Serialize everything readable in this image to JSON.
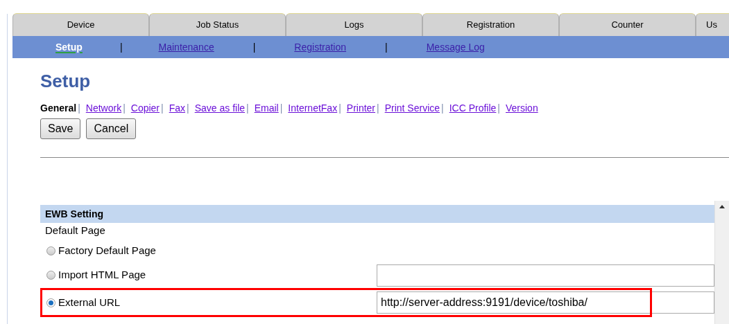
{
  "tabs": [
    {
      "label": "Device",
      "selected": false
    },
    {
      "label": "Job Status",
      "selected": false
    },
    {
      "label": "Logs",
      "selected": false
    },
    {
      "label": "Registration",
      "selected": false
    },
    {
      "label": "Counter",
      "selected": false
    },
    {
      "label": "Us",
      "selected": false
    }
  ],
  "subnav": {
    "items": [
      {
        "label": "Setup",
        "selected": true
      },
      {
        "label": "Maintenance",
        "selected": false
      },
      {
        "label": "Registration",
        "selected": false
      },
      {
        "label": "Message Log",
        "selected": false
      }
    ],
    "separators": [
      "|",
      "|",
      "|"
    ]
  },
  "page_title": "Setup",
  "section_links": {
    "items": [
      {
        "label": "General",
        "selected": true
      },
      {
        "label": "Network",
        "selected": false
      },
      {
        "label": "Copier",
        "selected": false
      },
      {
        "label": "Fax",
        "selected": false
      },
      {
        "label": "Save as file",
        "selected": false
      },
      {
        "label": "Email",
        "selected": false
      },
      {
        "label": "InternetFax",
        "selected": false
      },
      {
        "label": "Printer",
        "selected": false
      },
      {
        "label": "Print Service",
        "selected": false
      },
      {
        "label": "ICC Profile",
        "selected": false
      },
      {
        "label": "Version",
        "selected": false
      }
    ],
    "separators": [
      "|",
      "|",
      "|",
      "|",
      "|",
      "|",
      "|",
      "|",
      "|",
      "|"
    ]
  },
  "buttons": [
    "Save",
    "Cancel"
  ],
  "ewb": {
    "title": "EWB Setting",
    "label": "Default Page",
    "options": [
      {
        "label": "Factory Default Page",
        "selected": false,
        "highlighted": false
      },
      {
        "label": "Import HTML Page",
        "selected": false,
        "highlighted": false,
        "input": {
          "kind": "text"
        }
      },
      {
        "label": "External URL",
        "selected": true,
        "highlighted": true,
        "input": {
          "kind": "text",
          "value": "http://server-address:9191/device/toshiba/"
        }
      }
    ]
  }
}
